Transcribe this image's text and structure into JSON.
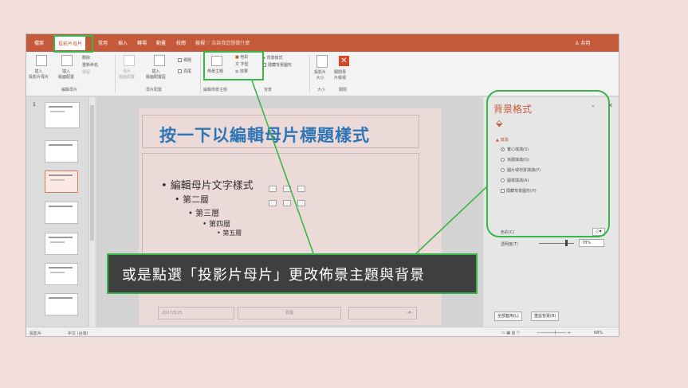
{
  "menubar": {
    "items": [
      "檔案",
      "投影片母片",
      "常用",
      "插入",
      "轉場",
      "動畫",
      "校閱",
      "檢視"
    ],
    "tellme": "告訴我您想做什麼",
    "share": "共用"
  },
  "ribbon": {
    "insert_master": "插入\n投影片母片",
    "insert_layout": "插入\n版面配置",
    "delete": "刪除",
    "rename": "重新命名",
    "preserve": "保留",
    "master_layout": "母片\n版面配置",
    "insert_placeholder": "插入\n版面配置區",
    "title_check": "標題",
    "footer_check": "頁尾",
    "themes": "佈景主題",
    "colors": "色彩",
    "fonts": "字型",
    "effects": "效果",
    "bg_styles": "背景樣式",
    "hide_bg": "隱藏背景圖形",
    "slide_size": "投影片\n大小",
    "close_master": "關閉母\n片檢視",
    "group_edit_master": "編輯母片",
    "group_master_layout": "母片配置",
    "group_edit_theme": "編輯佈景主題",
    "group_background": "背景",
    "group_size": "大小",
    "group_close": "關閉"
  },
  "thumbs": {
    "number": "1"
  },
  "slide": {
    "title": "按一下以編輯母片標題樣式",
    "level1": "• 編輯母片文字樣式",
    "level2": "• 第二層",
    "level3": "• 第三層",
    "level4": "• 第四層",
    "level5": "• 第五層",
    "footer_date": "2017/3/25",
    "footer_text": "頁尾",
    "footer_num": "‹#›"
  },
  "pane": {
    "title": "背景格式",
    "section": "填滿",
    "options": [
      "實心填滿(S)",
      "漸層填滿(G)",
      "圖片或材質填滿(P)",
      "圖樣填滿(A)",
      "隱藏背景圖形(H)"
    ],
    "color_label": "色彩(C)",
    "transparency_label": "透明度(T)",
    "transparency_value": "78%",
    "transparency_level": 0.78,
    "apply_all": "全部套用(L)",
    "reset": "重設背景(B)"
  },
  "statusbar": {
    "view": "投影片",
    "language": "中文 (台灣)",
    "zoom": "68%"
  },
  "callout": {
    "text": "或是點選「投影片母片」更改佈景主題與背景"
  },
  "colors": {
    "accent": "#c55a3a",
    "highlight": "#3ab54a",
    "title_blue": "#2e75b6"
  }
}
